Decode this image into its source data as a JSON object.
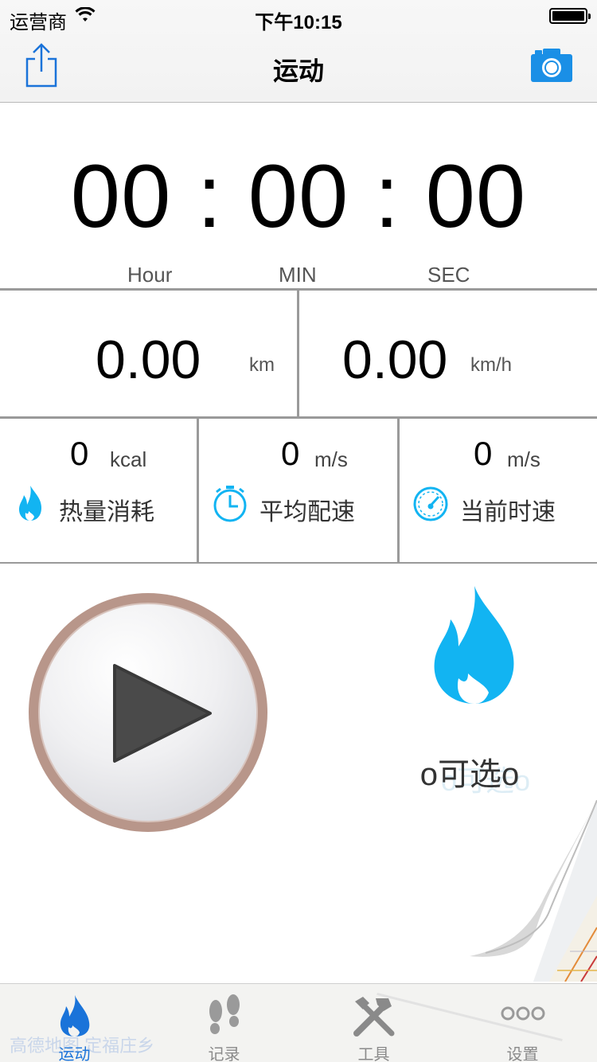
{
  "status_bar": {
    "carrier": "运营商",
    "time": "下午10:15"
  },
  "nav": {
    "title": "运动",
    "left_icon": "share-icon",
    "right_icon": "camera-icon"
  },
  "timer": {
    "display": "00 : 00 : 00",
    "labels": [
      "Hour",
      "MIN",
      "SEC"
    ]
  },
  "distance": {
    "value": "0.00",
    "unit": "km"
  },
  "speed": {
    "value": "0.00",
    "unit": "km/h"
  },
  "stats": [
    {
      "value": "0",
      "unit": "kcal",
      "label": "热量消耗",
      "icon": "flame-icon"
    },
    {
      "value": "0",
      "unit": "m/s",
      "label": "平均配速",
      "icon": "stopwatch-icon"
    },
    {
      "value": "0",
      "unit": "m/s",
      "label": "当前时速",
      "icon": "speedometer-icon"
    }
  ],
  "controls": {
    "play_icon": "play-icon",
    "optional_label": "o可选o",
    "optional_ghost": "o可选o"
  },
  "tab_bar": {
    "map_watermark": "高德地图 定福庄乡",
    "tabs": [
      {
        "label": "运动",
        "icon": "flame-icon",
        "active": true
      },
      {
        "label": "记录",
        "icon": "footprints-icon",
        "active": false
      },
      {
        "label": "工具",
        "icon": "tools-icon",
        "active": false
      },
      {
        "label": "设置",
        "icon": "more-icon",
        "active": false
      }
    ]
  },
  "colors": {
    "accent_blue": "#1a73d9",
    "flame_cyan": "#12b4f2",
    "divider": "#9a9a9a"
  }
}
